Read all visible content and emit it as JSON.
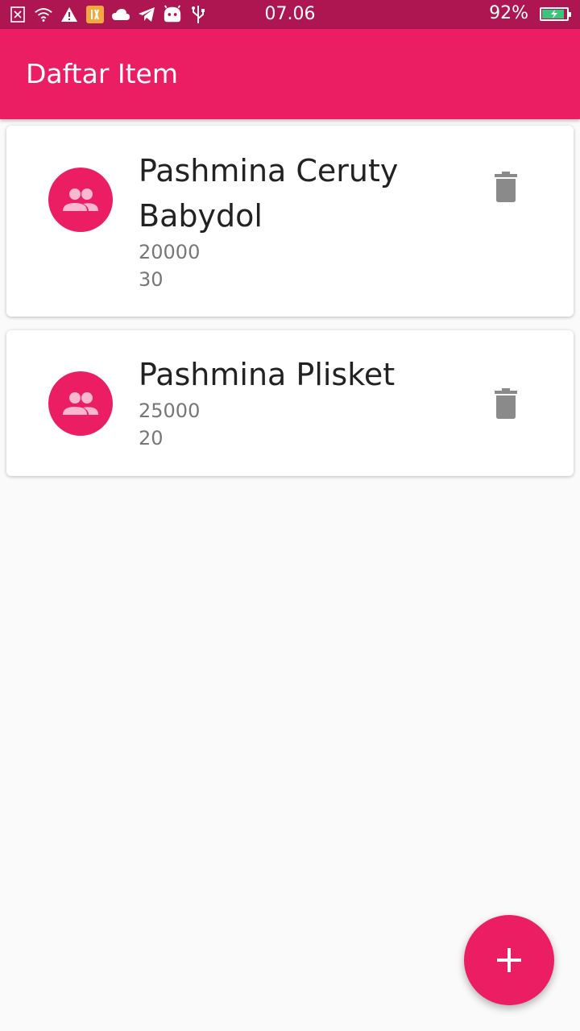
{
  "status_bar": {
    "time": "07.06",
    "battery_percent_label": "92%",
    "battery_level": 0.92,
    "icons": [
      "sim-off-icon",
      "wifi-icon",
      "warning-icon",
      "app-notification-icon",
      "cloud-icon",
      "telegram-icon",
      "android-icon",
      "usb-icon"
    ]
  },
  "app_bar": {
    "title": "Daftar Item"
  },
  "items": [
    {
      "name": "Pashmina Ceruty Babydol",
      "price": "20000",
      "stock": "30"
    },
    {
      "name": "Pashmina Plisket",
      "price": "25000",
      "stock": "20"
    }
  ],
  "colors": {
    "primary": "#eb1e63",
    "status_bar": "#ad1650",
    "background": "#fafafa",
    "icon_gray": "#8a8a8a"
  },
  "fab": {
    "icon": "plus-icon"
  }
}
